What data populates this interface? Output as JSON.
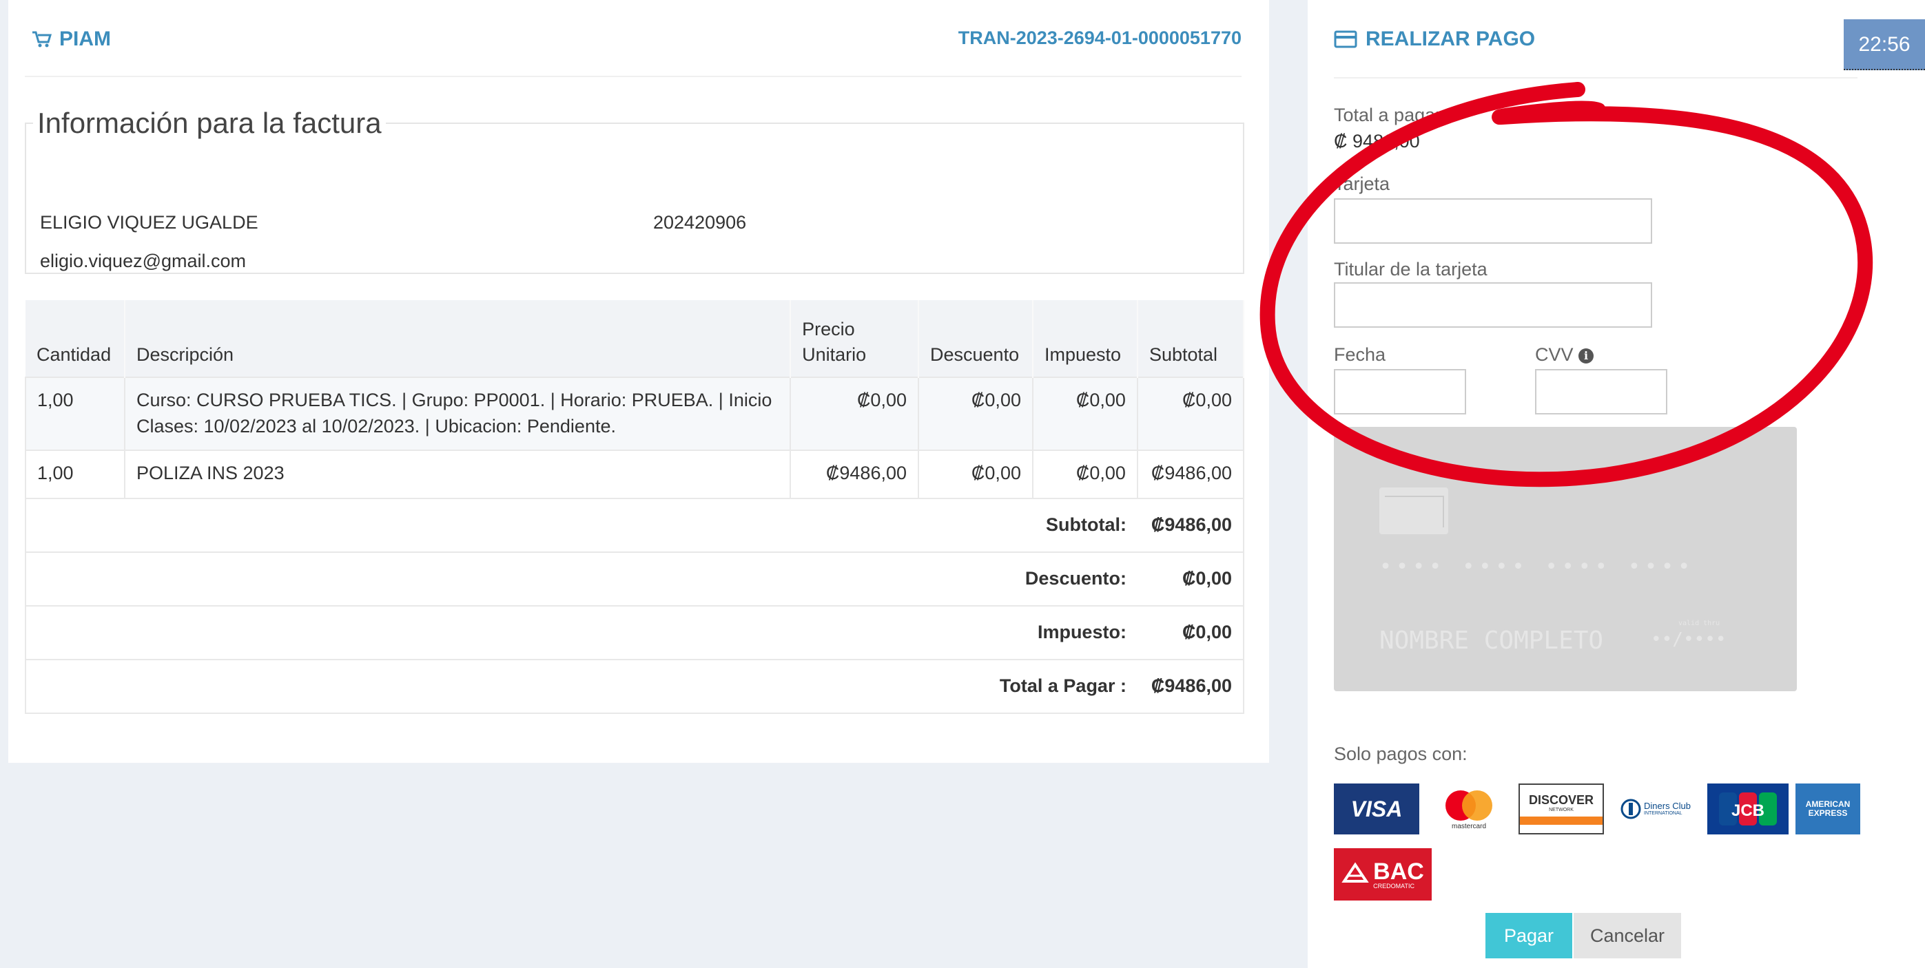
{
  "invoice": {
    "brand": "PIAM",
    "transaction_id": "TRAN-2023-2694-01-0000051770",
    "section_title": "Información para la factura",
    "customer_name": "ELIGIO VIQUEZ UGALDE",
    "customer_id": "202420906",
    "customer_email": "eligio.viquez@gmail.com",
    "columns": [
      "Cantidad",
      "Descripción",
      "Precio Unitario",
      "Descuento",
      "Impuesto",
      "Subtotal"
    ],
    "items": [
      {
        "cantidad": "1,00",
        "descripcion": "Curso: CURSO PRUEBA TICS. | Grupo: PP0001. | Horario: PRUEBA. | Inicio Clases: 10/02/2023 al 10/02/2023. | Ubicacion: Pendiente.",
        "precio": "₡0,00",
        "descuento": "₡0,00",
        "impuesto": "₡0,00",
        "subtotal": "₡0,00"
      },
      {
        "cantidad": "1,00",
        "descripcion": "POLIZA INS 2023",
        "precio": "₡9486,00",
        "descuento": "₡0,00",
        "impuesto": "₡0,00",
        "subtotal": "₡9486,00"
      }
    ],
    "totals": [
      {
        "label": "Subtotal:",
        "value": "₡9486,00"
      },
      {
        "label": "Descuento:",
        "value": "₡0,00"
      },
      {
        "label": "Impuesto:",
        "value": "₡0,00"
      },
      {
        "label": "Total a Pagar :",
        "value": "₡9486,00"
      }
    ]
  },
  "payment": {
    "title": "REALIZAR PAGO",
    "clock": "22:56",
    "total_label": "Total a pagar",
    "total_value": "₡ 9486,00",
    "card_label": "Tarjeta",
    "holder_label": "Titular de la tarjeta",
    "date_label": "Fecha",
    "cvv_label": "CVV",
    "card_preview": {
      "number": "•••• •••• •••• ••••",
      "name": "NOMBRE COMPLETO",
      "expiry": "••/••••",
      "expiry_caption": "valid thru"
    },
    "accepted_label": "Solo pagos con:",
    "logos": [
      "VISA",
      "mastercard",
      "DISCOVER",
      "Diners Club International",
      "JCB",
      "AMERICAN EXPRESS",
      "BAC CREDOMATIC"
    ],
    "logo_text": {
      "visa": "VISA",
      "mastercard": "mastercard",
      "discover": "DISCOVER",
      "discover_sub": "NETWORK",
      "diners": "Diners Club",
      "diners_sub": "INTERNATIONAL",
      "amex_1": "AMERICAN",
      "amex_2": "EXPRESS",
      "bac": "BAC",
      "bac_sub": "CREDOMATIC"
    },
    "pay_button": "Pagar",
    "cancel_button": "Cancelar"
  },
  "colors": {
    "accent": "#3c8dbc",
    "pay_button": "#41c6d6",
    "annotation": "#e3001b",
    "background": "#ecf0f5"
  },
  "icons": [
    "cart-icon",
    "credit-card-icon",
    "info-circle-icon"
  ]
}
